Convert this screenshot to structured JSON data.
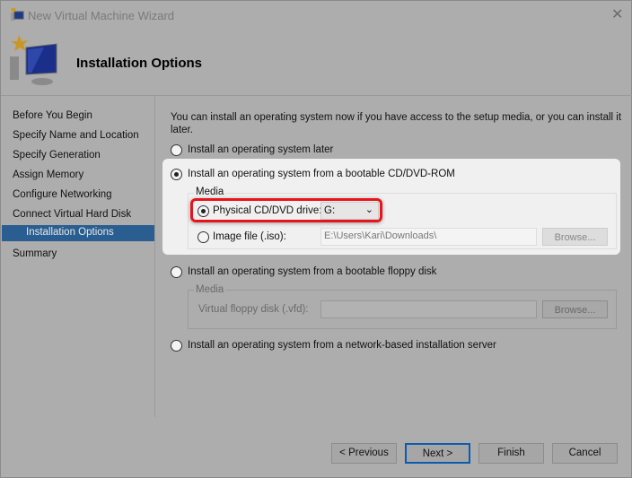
{
  "window": {
    "title": "New Virtual Machine Wizard",
    "heading": "Installation Options"
  },
  "sidebar": {
    "items": [
      {
        "label": "Before You Begin"
      },
      {
        "label": "Specify Name and Location"
      },
      {
        "label": "Specify Generation"
      },
      {
        "label": "Assign Memory"
      },
      {
        "label": "Configure Networking"
      },
      {
        "label": "Connect Virtual Hard Disk"
      },
      {
        "label": "Installation Options",
        "selected": true
      },
      {
        "label": "Summary"
      }
    ]
  },
  "main": {
    "intro": "You can install an operating system now if you have access to the setup media, or you can install it later.",
    "opt_later": "Install an operating system later",
    "opt_cd": "Install an operating system from a bootable CD/DVD-ROM",
    "media_label": "Media",
    "physical_label": "Physical CD/DVD drive:",
    "physical_value": "G:",
    "image_label": "Image file (.iso):",
    "image_value": "E:\\Users\\Kari\\Downloads\\",
    "browse": "Browse...",
    "opt_floppy": "Install an operating system from a bootable floppy disk",
    "floppy_media_label": "Media",
    "floppy_label": "Virtual floppy disk (.vfd):",
    "floppy_value": "",
    "floppy_browse": "Browse...",
    "opt_network": "Install an operating system from a network-based installation server",
    "selected_option": "cd",
    "selected_media": "physical"
  },
  "buttons": {
    "previous": "< Previous",
    "next": "Next >",
    "finish": "Finish",
    "cancel": "Cancel"
  },
  "colors": {
    "highlight": "#e8141c",
    "selection": "#2a5e90",
    "default_button_border": "#0a5cad"
  }
}
